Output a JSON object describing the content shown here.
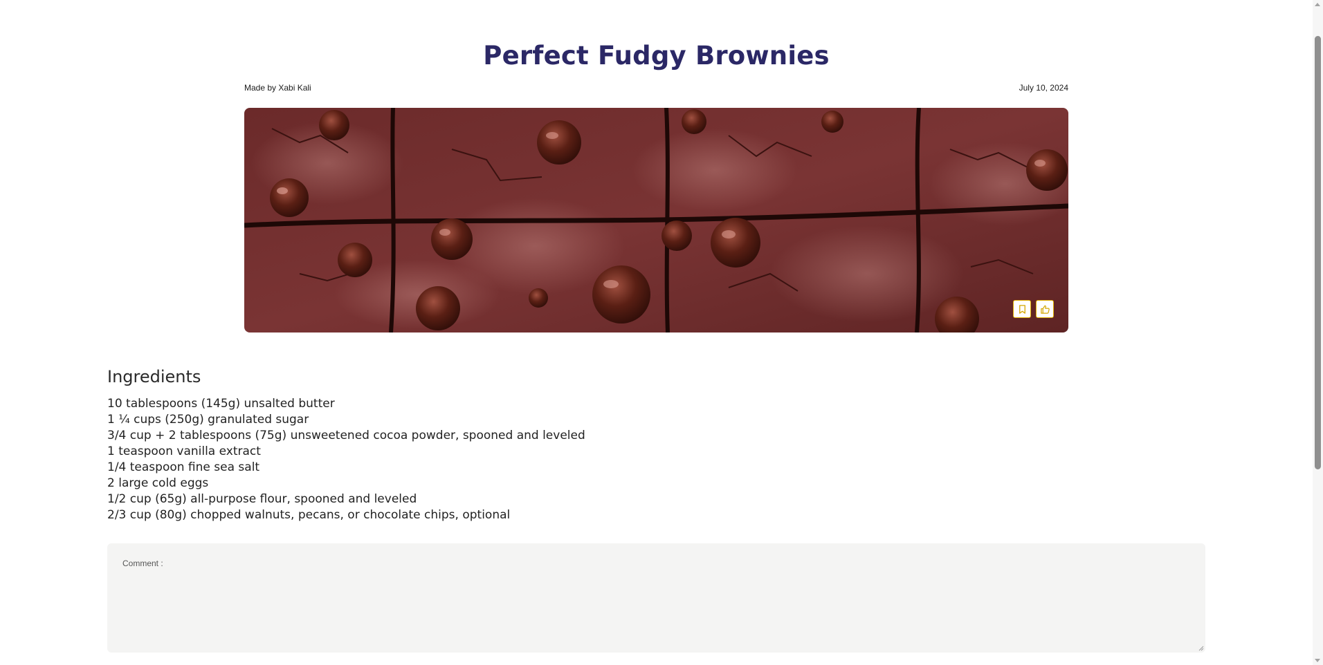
{
  "recipe": {
    "title": "Perfect Fudgy Brownies",
    "author_line": "Made by Xabi Kali",
    "date": "July 10, 2024",
    "image_subject": "brownie-closeup-photo"
  },
  "actions": {
    "bookmark_icon": "bookmark-icon",
    "like_icon": "thumbs-up-icon",
    "accent_color": "#e3b400"
  },
  "ingredients": {
    "heading": "Ingredients",
    "items": [
      "10 tablespoons (145g) unsalted butter",
      "1 ¼ cups (250g) granulated sugar",
      "3/4 cup + 2 tablespoons (75g) unsweetened cocoa powder, spooned and leveled",
      "1 teaspoon vanilla extract",
      "1/4 teaspoon fine sea salt",
      "2 large cold eggs",
      "1/2 cup (65g) all-purpose flour, spooned and leveled",
      "2/3 cup (80g) chopped walnuts, pecans, or chocolate chips, optional"
    ]
  },
  "comment": {
    "label": "Comment :",
    "value": ""
  },
  "colors": {
    "title": "#2b2866",
    "comment_bg": "#f4f4f3"
  }
}
